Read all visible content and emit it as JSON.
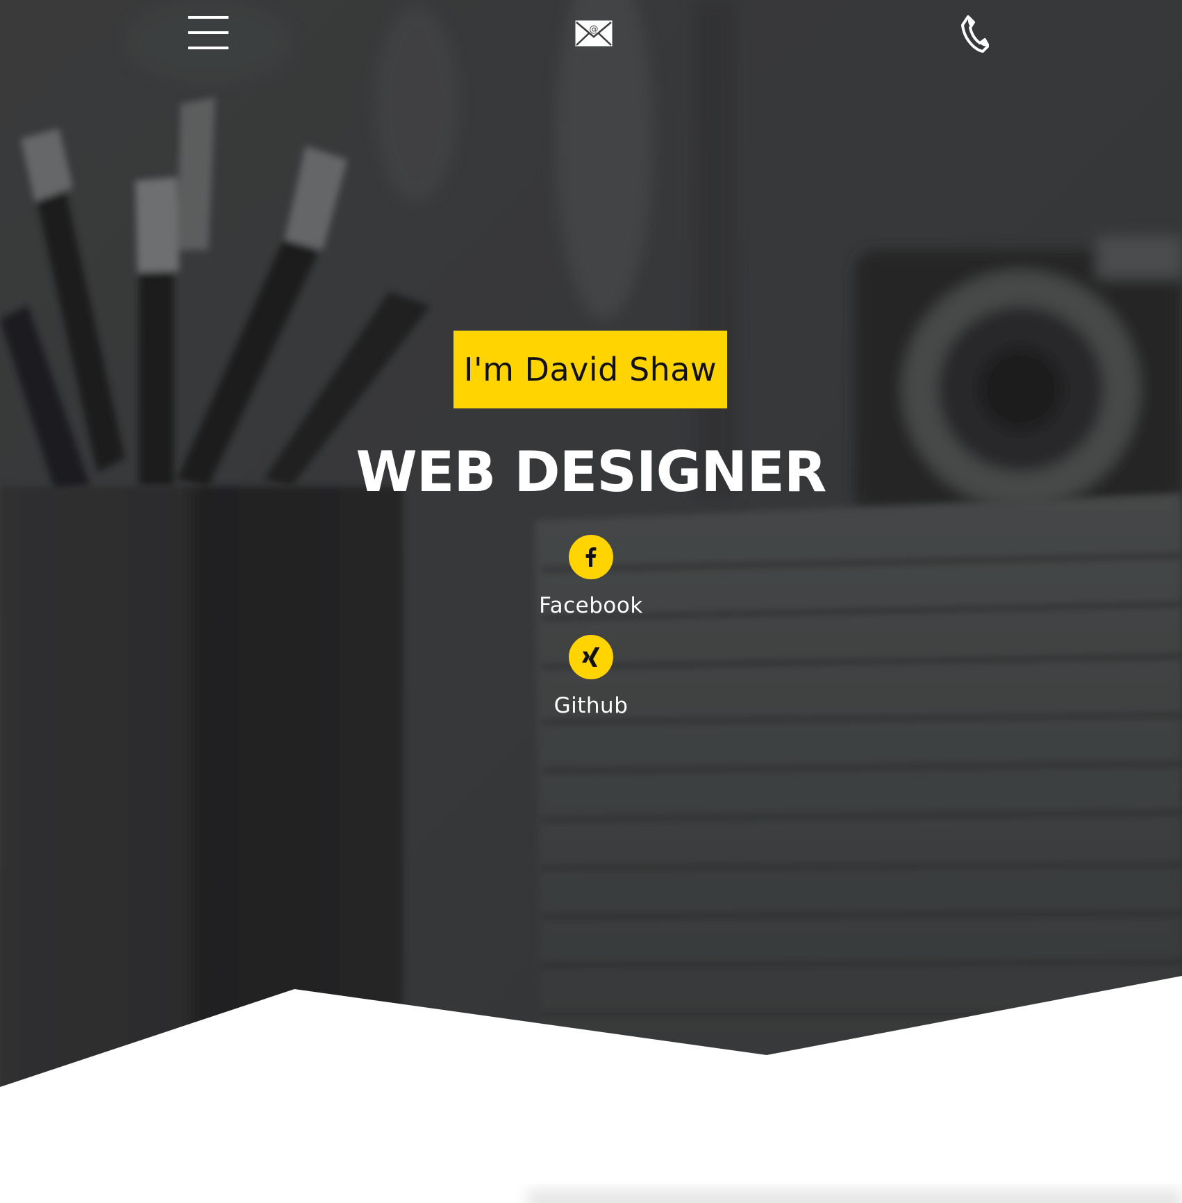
{
  "header": {
    "menu_icon": "hamburger-menu-icon",
    "mail_icon": "envelope-at-icon",
    "phone_icon": "phone-handset-icon"
  },
  "hero": {
    "greeting": "I'm David Shaw",
    "role": "WEB DESIGNER"
  },
  "social": [
    {
      "label": "Facebook",
      "icon": "facebook-icon"
    },
    {
      "label": "Github",
      "icon": "xing-icon"
    }
  ],
  "colors": {
    "accent": "#ffd400",
    "overlay": "#3a3b3b",
    "text_light": "#ffffff",
    "text_dark": "#111111",
    "section_bg": "#ffffff"
  }
}
